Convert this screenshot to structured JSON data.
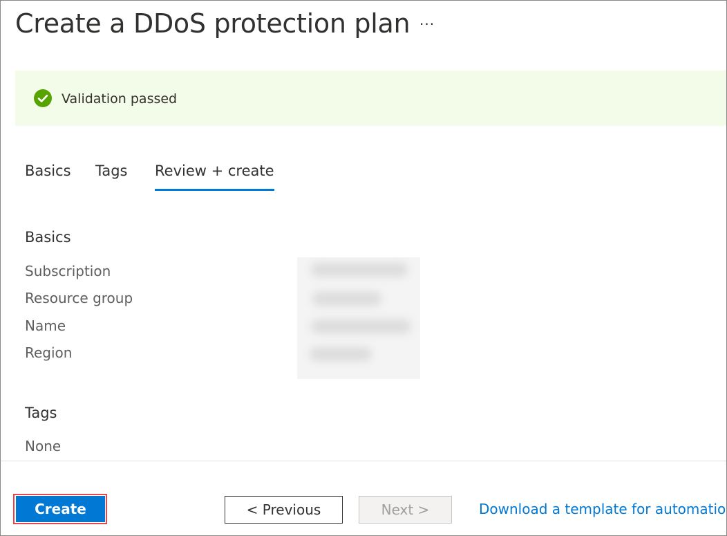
{
  "header": {
    "title": "Create a DDoS protection plan",
    "more_label": "···"
  },
  "banner": {
    "icon": "check-circle-icon",
    "text": "Validation passed",
    "icon_color": "#57a300",
    "background": "#f3fbe9"
  },
  "tabs": [
    {
      "label": "Basics",
      "active": false
    },
    {
      "label": "Tags",
      "active": false
    },
    {
      "label": "Review + create",
      "active": true
    }
  ],
  "basics": {
    "heading": "Basics",
    "fields": [
      {
        "label": "Subscription"
      },
      {
        "label": "Resource group"
      },
      {
        "label": "Name"
      },
      {
        "label": "Region"
      }
    ]
  },
  "tags_section": {
    "heading": "Tags",
    "value": "None"
  },
  "footer": {
    "create_label": "Create",
    "previous_label": "< Previous",
    "next_label": "Next >",
    "next_disabled": true,
    "download_link": "Download a template for automation"
  },
  "colors": {
    "accent": "#0078d4",
    "highlight_outline": "#e8474a",
    "success": "#57a300"
  }
}
